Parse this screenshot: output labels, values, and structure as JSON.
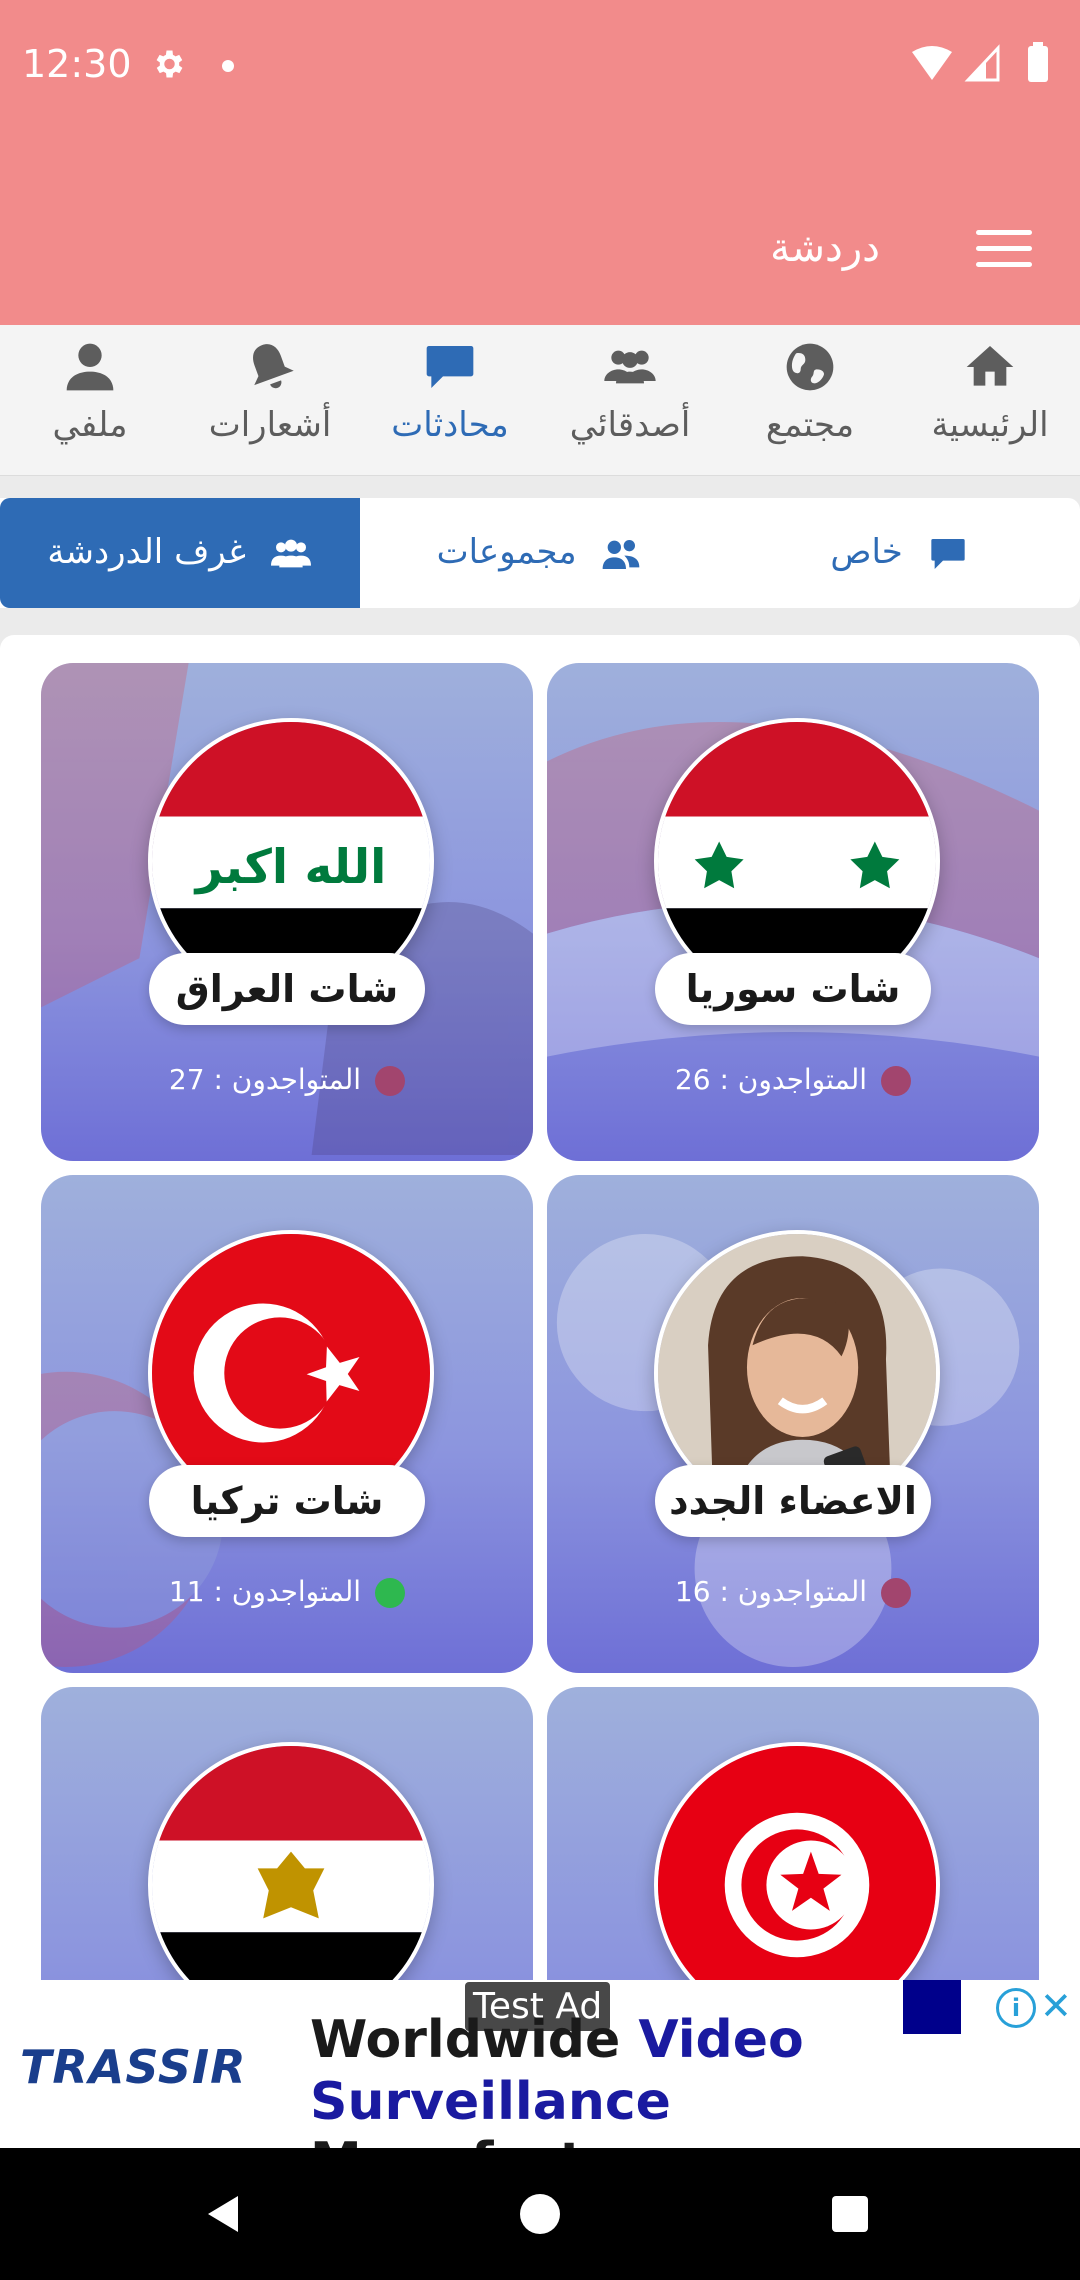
{
  "status": {
    "time": "12:30"
  },
  "appbar": {
    "title": "دردشة"
  },
  "nav": [
    {
      "label": "الرئيسية",
      "icon": "home-icon"
    },
    {
      "label": "مجتمع",
      "icon": "globe-icon"
    },
    {
      "label": "أصدقائي",
      "icon": "friends-icon"
    },
    {
      "label": "محادثات",
      "icon": "chat-bubble-icon",
      "active": true
    },
    {
      "label": "أشعارات",
      "icon": "bell-icon"
    },
    {
      "label": "ملفي",
      "icon": "profile-icon"
    }
  ],
  "tabs": [
    {
      "label": "خاص",
      "icon": "chat-bubble-icon"
    },
    {
      "label": "مجموعات",
      "icon": "group-icon"
    },
    {
      "label": "غرف الدردشة",
      "icon": "rooms-icon",
      "active": true
    }
  ],
  "rooms": [
    {
      "name": "شات سوريا",
      "online_label": "المتواجدون : 26",
      "status_color": "#a2456e",
      "flag": "syria"
    },
    {
      "name": "شات العراق",
      "online_label": "المتواجدون : 27",
      "status_color": "#a2456e",
      "flag": "iraq"
    },
    {
      "name": "الاعضاء الجدد",
      "online_label": "المتواجدون : 16",
      "status_color": "#a2456e",
      "flag": "portrait"
    },
    {
      "name": "شات تركيا",
      "online_label": "المتواجدون : 11",
      "status_color": "#2eb84f",
      "flag": "turkey"
    },
    {
      "name": "",
      "online_label": "",
      "flag": "tunisia"
    },
    {
      "name": "",
      "online_label": "",
      "flag": "egypt"
    }
  ],
  "iraq_flag_text": "الله اكبر",
  "ad": {
    "tag": "Test Ad",
    "brand": "TRASSIR",
    "line1_a": "Worldwide",
    "line1_b": "Video",
    "line2_a": "Surveillance",
    "line2_b": "Manufacturer"
  },
  "colors": {
    "header": "#f28b8b",
    "accent": "#2e6bb5"
  }
}
